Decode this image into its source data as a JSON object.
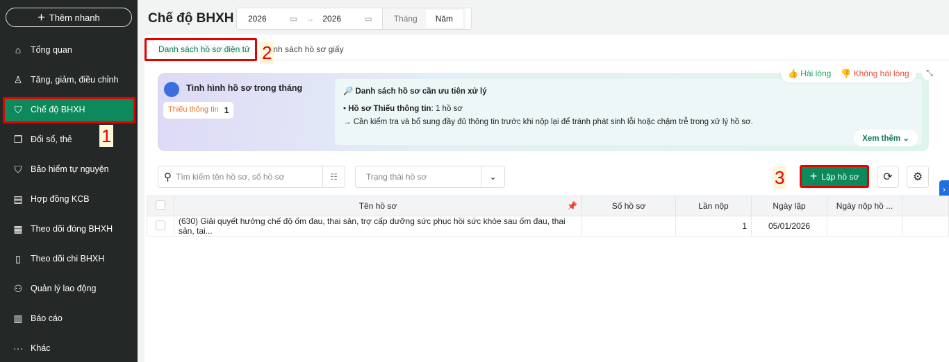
{
  "sidebar": {
    "quick_add": "Thêm nhanh",
    "items": [
      {
        "label": "Tổng quan",
        "icon": "home-icon"
      },
      {
        "label": "Tăng, giảm, điều chỉnh",
        "icon": "user-icon"
      },
      {
        "label": "Chế độ BHXH",
        "icon": "shield-icon"
      },
      {
        "label": "Đổi sổ, thẻ",
        "icon": "copy-icon"
      },
      {
        "label": "Bảo hiểm tự nguyện",
        "icon": "shield-icon"
      },
      {
        "label": "Hợp đồng KCB",
        "icon": "document-icon"
      },
      {
        "label": "Theo dõi đóng BHXH",
        "icon": "calendar-icon"
      },
      {
        "label": "Theo dõi chi BHXH",
        "icon": "file-icon"
      },
      {
        "label": "Quản lý lao động",
        "icon": "users-icon"
      },
      {
        "label": "Báo cáo",
        "icon": "report-icon"
      },
      {
        "label": "Khác",
        "icon": "more-icon"
      }
    ]
  },
  "annotations": {
    "n1": "1",
    "n2": "2",
    "n3": "3"
  },
  "header": {
    "title": "Chế độ BHXH",
    "from": "2026",
    "to": "2026",
    "month": "Tháng",
    "year": "Năm"
  },
  "tabs": [
    "Danh sách hồ sơ điện tử",
    "Danh sách hồ sơ giấy"
  ],
  "banner": {
    "title": "Tình hình hồ sơ trong tháng",
    "badge_label": "Thiếu thông tin",
    "badge_count": "1",
    "like": "Hài lòng",
    "dislike": "Không hài lòng",
    "priority_title": "Danh sách hồ sơ cần ưu tiên xử lý",
    "bullet_bold": "Hồ sơ Thiếu thông tin",
    "bullet_rest": ": 1 hồ sơ",
    "advice": "→ Cần kiểm tra và bổ sung đầy đủ thông tin trước khi nộp lại để tránh phát sinh lỗi hoặc chậm trễ trong xử lý hồ sơ.",
    "more": "Xem thêm"
  },
  "toolbar": {
    "search_placeholder": "Tìm kiếm tên hồ sơ, số hồ sơ",
    "status_placeholder": "Trạng thái hồ sơ",
    "create": "Lập hồ sơ"
  },
  "table": {
    "headers": [
      "Tên hồ sơ",
      "Số hồ sơ",
      "Lần nộp",
      "Ngày lập",
      "Ngày nộp hồ ..."
    ],
    "rows": [
      {
        "name": "(630) Giải quyết hưởng chế độ ốm đau, thai sản, trợ cấp dưỡng sức phục hồi sức khỏe sau ốm đau, thai sản, tai...",
        "number": "",
        "times": "1",
        "created": "05/01/2026",
        "submitted": ""
      }
    ]
  }
}
